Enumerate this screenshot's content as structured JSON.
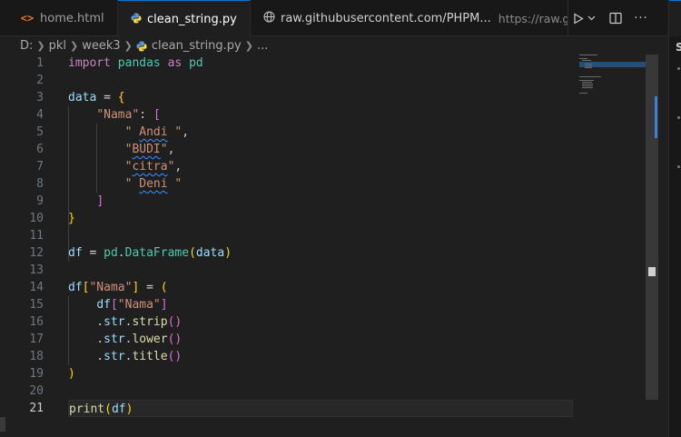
{
  "tabs": [
    {
      "label": "home.html",
      "icon": "html-icon",
      "active": false
    },
    {
      "label": "clean_string.py",
      "icon": "python-icon",
      "active": true,
      "modified": true
    },
    {
      "label": "raw.githubusercontent.com/PHPM...",
      "description": "https://raw.githubus",
      "icon": "globe-icon",
      "active": false
    }
  ],
  "actions": {
    "run": "▷",
    "chevron": "⌵",
    "split": "◫",
    "more": "···"
  },
  "right_panel": {
    "letter": "S"
  },
  "breadcrumb": {
    "drive": "D:",
    "folder1": "pkl",
    "folder2": "week3",
    "file": "clean_string.py",
    "ellipsis": "..."
  },
  "editor": {
    "line_numbers": [
      "1",
      "2",
      "3",
      "4",
      "5",
      "6",
      "7",
      "8",
      "9",
      "10",
      "11",
      "12",
      "13",
      "14",
      "15",
      "16",
      "17",
      "18",
      "19",
      "20",
      "21"
    ],
    "current_line": 21,
    "lines": [
      [
        {
          "t": "import",
          "c": "kw"
        },
        {
          "t": " "
        },
        {
          "t": "pandas",
          "c": "mod"
        },
        {
          "t": " "
        },
        {
          "t": "as",
          "c": "kw"
        },
        {
          "t": " "
        },
        {
          "t": "pd",
          "c": "mod"
        }
      ],
      [],
      [
        {
          "t": "data",
          "c": "var"
        },
        {
          "t": " = ",
          "c": "op"
        },
        {
          "t": "{",
          "c": "br1"
        }
      ],
      [
        {
          "t": "    "
        },
        {
          "t": "\"Nama\"",
          "c": "str"
        },
        {
          "t": ": "
        },
        {
          "t": "[",
          "c": "br2"
        }
      ],
      [
        {
          "t": "        "
        },
        {
          "t": "\" ",
          "c": "str"
        },
        {
          "t": "Andi",
          "c": "str sq"
        },
        {
          "t": " \"",
          "c": "str"
        },
        {
          "t": ","
        }
      ],
      [
        {
          "t": "        "
        },
        {
          "t": "\"",
          "c": "str"
        },
        {
          "t": "BUDI",
          "c": "str sq"
        },
        {
          "t": "\"",
          "c": "str"
        },
        {
          "t": ","
        }
      ],
      [
        {
          "t": "        "
        },
        {
          "t": "\"",
          "c": "str"
        },
        {
          "t": "citra",
          "c": "str sq"
        },
        {
          "t": "\"",
          "c": "str"
        },
        {
          "t": ","
        }
      ],
      [
        {
          "t": "        "
        },
        {
          "t": "\" ",
          "c": "str"
        },
        {
          "t": "Deni",
          "c": "str sq"
        },
        {
          "t": " \"",
          "c": "str"
        }
      ],
      [
        {
          "t": "    "
        },
        {
          "t": "]",
          "c": "br2"
        }
      ],
      [
        {
          "t": "}",
          "c": "br1"
        }
      ],
      [],
      [
        {
          "t": "df",
          "c": "var"
        },
        {
          "t": " = ",
          "c": "op"
        },
        {
          "t": "pd",
          "c": "mod"
        },
        {
          "t": "."
        },
        {
          "t": "DataFrame",
          "c": "mod"
        },
        {
          "t": "(",
          "c": "br1"
        },
        {
          "t": "data",
          "c": "var"
        },
        {
          "t": ")",
          "c": "br1"
        }
      ],
      [],
      [
        {
          "t": "df",
          "c": "var"
        },
        {
          "t": "[",
          "c": "br1"
        },
        {
          "t": "\"Nama\"",
          "c": "str"
        },
        {
          "t": "]",
          "c": "br1"
        },
        {
          "t": " = ",
          "c": "op"
        },
        {
          "t": "(",
          "c": "br1"
        }
      ],
      [
        {
          "t": "    "
        },
        {
          "t": "df",
          "c": "var"
        },
        {
          "t": "[",
          "c": "br2"
        },
        {
          "t": "\"Nama\"",
          "c": "str"
        },
        {
          "t": "]",
          "c": "br2"
        }
      ],
      [
        {
          "t": "    ."
        },
        {
          "t": "str",
          "c": "var"
        },
        {
          "t": "."
        },
        {
          "t": "strip",
          "c": "fn"
        },
        {
          "t": "()",
          "c": "br2"
        }
      ],
      [
        {
          "t": "    ."
        },
        {
          "t": "str",
          "c": "var"
        },
        {
          "t": "."
        },
        {
          "t": "lower",
          "c": "fn"
        },
        {
          "t": "()",
          "c": "br2"
        }
      ],
      [
        {
          "t": "    ."
        },
        {
          "t": "str",
          "c": "var"
        },
        {
          "t": "."
        },
        {
          "t": "title",
          "c": "fn"
        },
        {
          "t": "()",
          "c": "br2"
        }
      ],
      [
        {
          "t": ")",
          "c": "br1"
        }
      ],
      [],
      [
        {
          "t": "print",
          "c": "fn"
        },
        {
          "t": "(",
          "c": "br1"
        },
        {
          "t": "df",
          "c": "var"
        },
        {
          "t": ")",
          "c": "br1"
        }
      ]
    ]
  },
  "colors": {
    "accent": "#0078d4",
    "editor_bg": "#1f1f1f",
    "tabbar_bg": "#181818"
  }
}
